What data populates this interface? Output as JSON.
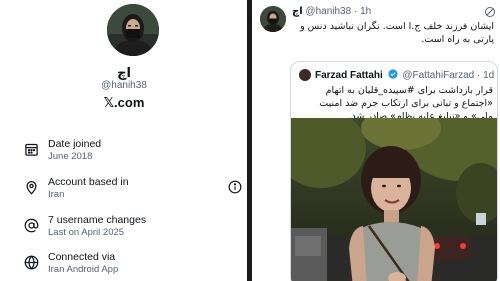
{
  "profile": {
    "display_name": "اچ",
    "handle": "@hanih38",
    "platform_label": "𝕏.com",
    "about": [
      {
        "icon": "calendar-icon",
        "title": "Date joined",
        "value": "June 2018"
      },
      {
        "icon": "location-icon",
        "title": "Account based in",
        "value": "Iran"
      },
      {
        "icon": "at-sign-icon",
        "title": "7 username changes",
        "value": "Last on April 2025"
      },
      {
        "icon": "globe-icon",
        "title": "Connected via",
        "value": "Iran Android App"
      }
    ]
  },
  "tweet": {
    "author_name": "اچ",
    "author_handle": "@hanih38",
    "time": "1h",
    "text": "ایشان فرزند خلف ج.ا است. نگران نباشید دنس و پارتی به راه است.",
    "quoted": {
      "author_name": "Farzad Fattahi",
      "author_handle": "@FattahiFarzad",
      "time": "1d",
      "text": "قرار بازداشت برای #سپیده_قلیان به اتهام «اجتماع و تبانی برای ارتکاب جرم ضد امنیت ملی» و «تبلیغ علیه نظام» صادر شد."
    }
  },
  "colors": {
    "text_primary": "#0f1419",
    "text_secondary": "#536471",
    "verified_blue": "#1d9bf0",
    "divider": "#1a1a1a"
  }
}
